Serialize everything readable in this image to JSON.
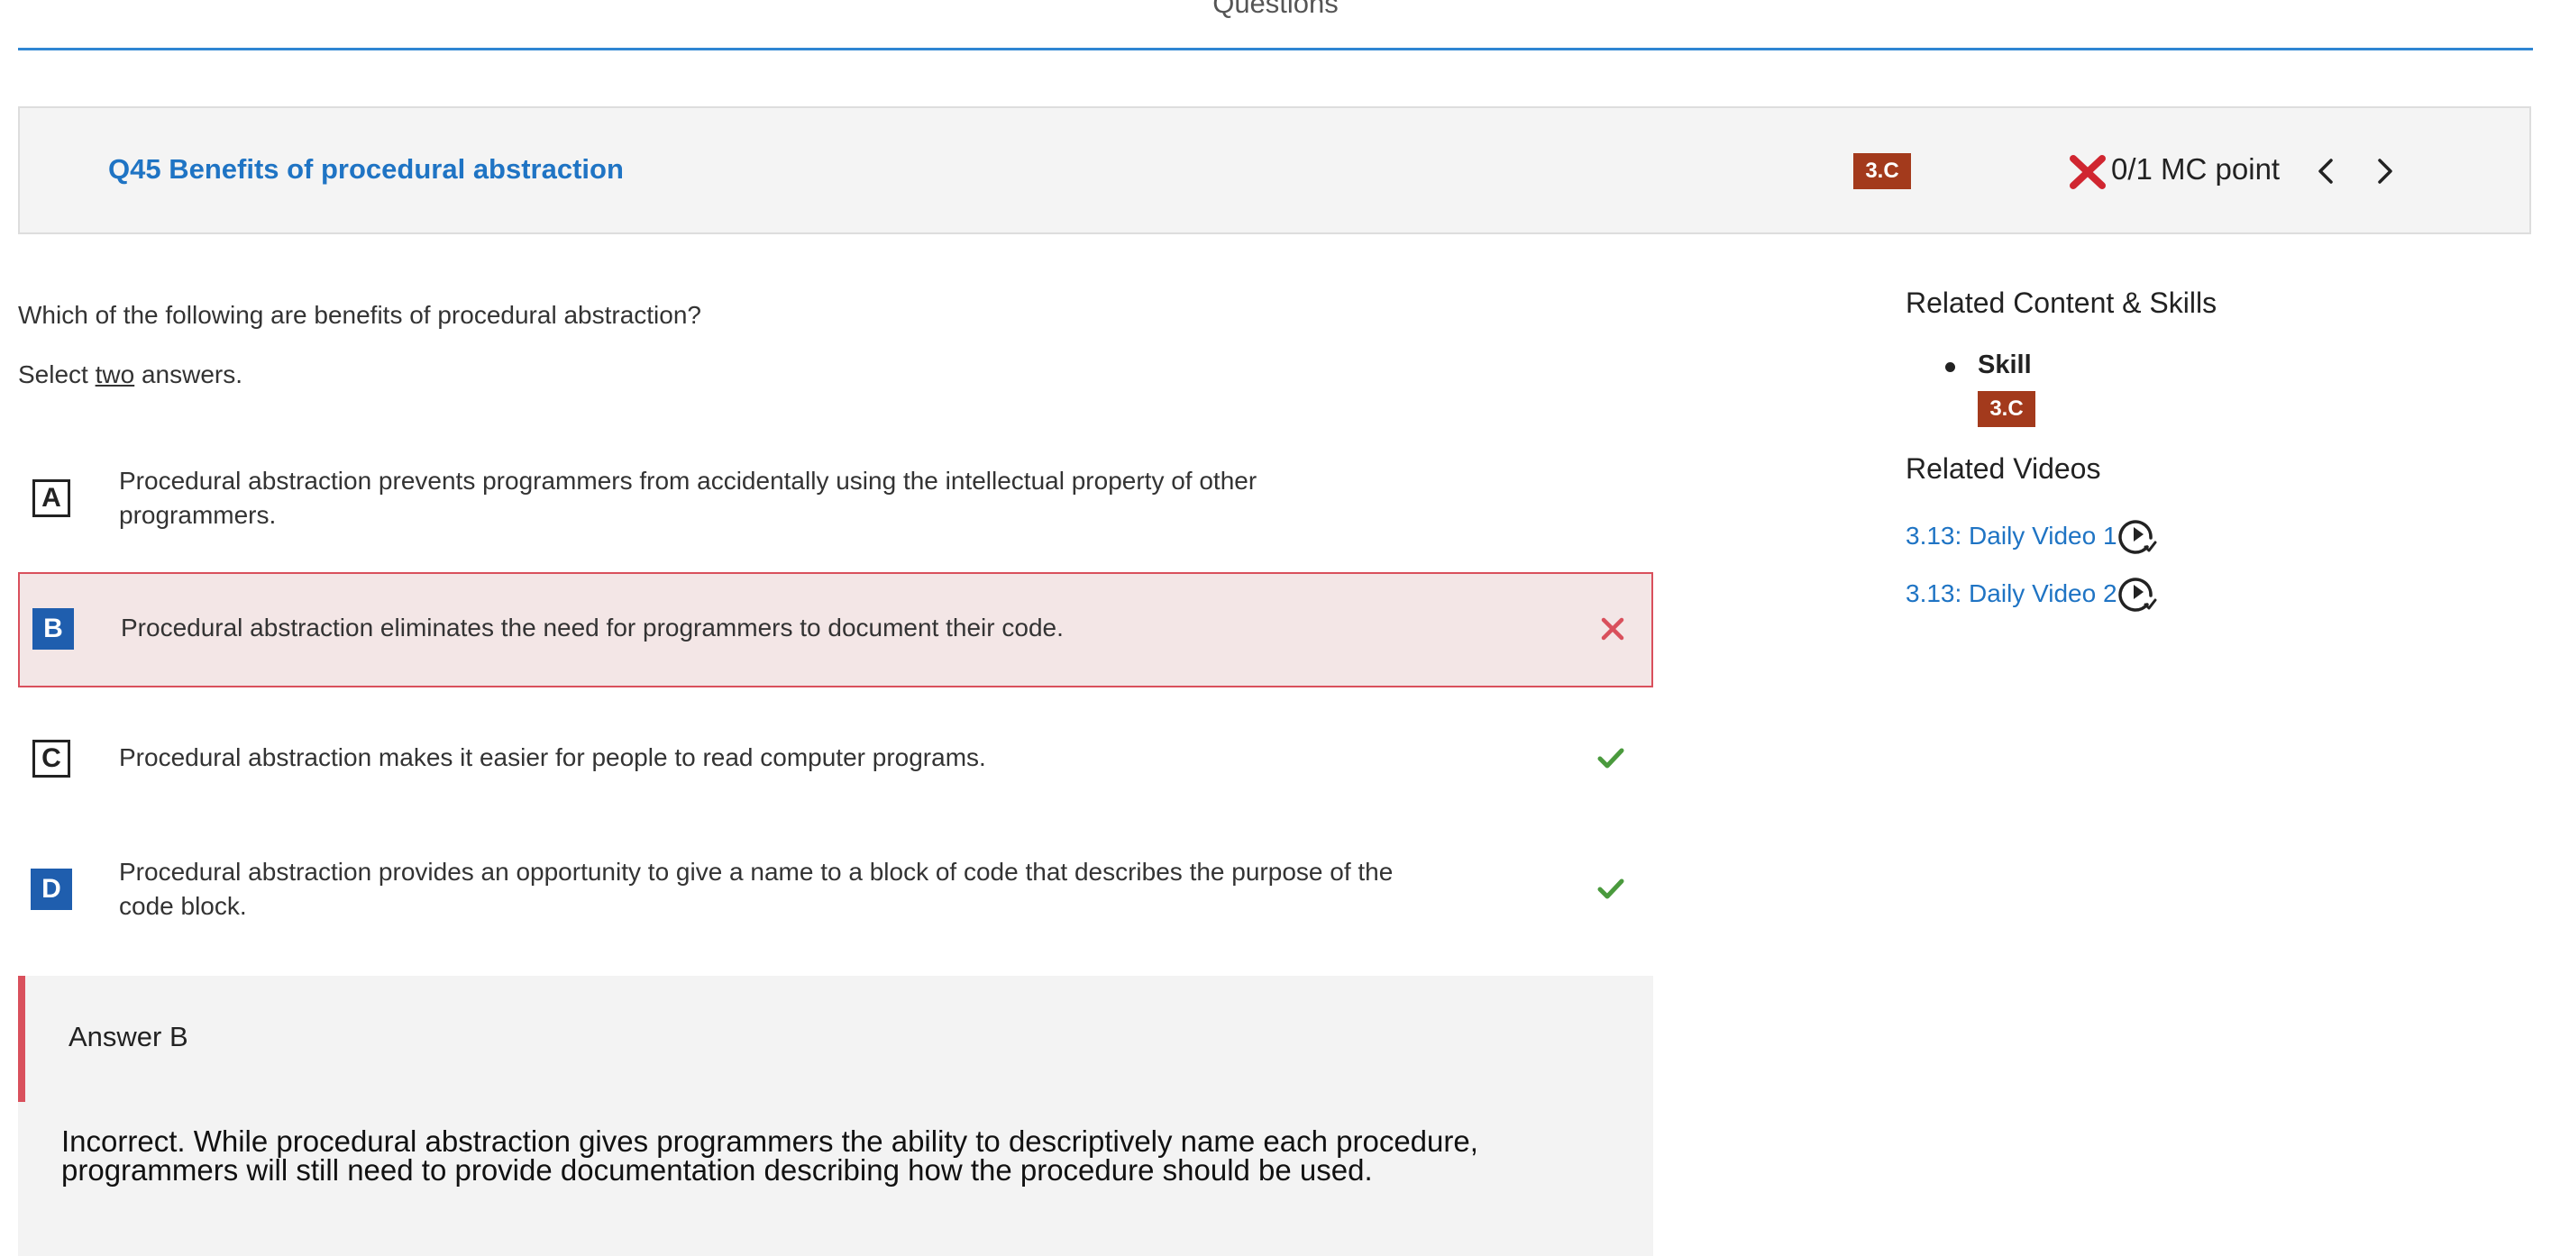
{
  "tab": {
    "title": "Questions"
  },
  "header": {
    "question_title": "Q45 Benefits of procedural abstraction",
    "skill_badge": "3.C",
    "score": "0/1 MC point"
  },
  "question": {
    "prompt": "Which of the following are benefits of procedural abstraction?",
    "instruction_prefix": "Select ",
    "instruction_emphasis": "two",
    "instruction_suffix": " answers."
  },
  "options": [
    {
      "letter": "A",
      "text": "Procedural abstraction prevents programmers from accidentally using the intellectual property of other programmers.",
      "selected": false,
      "mark": "none"
    },
    {
      "letter": "B",
      "text": "Procedural abstraction eliminates the need for programmers to document their code.",
      "selected": true,
      "mark": "incorrect"
    },
    {
      "letter": "C",
      "text": "Procedural abstraction makes it easier for people to read computer programs.",
      "selected": false,
      "mark": "correct"
    },
    {
      "letter": "D",
      "text": "Procedural abstraction provides an opportunity to give a name to a block of code that describes the purpose of the code block.",
      "selected": true,
      "mark": "correct"
    }
  ],
  "answer": {
    "label": "Answer B",
    "explanation": "Incorrect. While procedural abstraction gives programmers the ability to descriptively name each procedure, programmers will still need to provide documentation describing how the procedure should be used."
  },
  "sidebar": {
    "related_heading": "Related Content & Skills",
    "skill_label": "Skill",
    "skill_badge": "3.C",
    "videos_heading": "Related Videos",
    "videos": [
      {
        "label": "3.13: Daily Video 1",
        "icon": "play-circle-icon"
      },
      {
        "label": "3.13: Daily Video 2",
        "icon": "play-circle-icon"
      }
    ]
  },
  "colors": {
    "accent": "#1f74c4",
    "tab_underline": "#2f86d3",
    "skill_badge": "#a33a1c",
    "incorrect": "#d9505c",
    "correct": "#4a9a3d",
    "selected_letter": "#1f5eae",
    "header_x": "#d02630"
  }
}
